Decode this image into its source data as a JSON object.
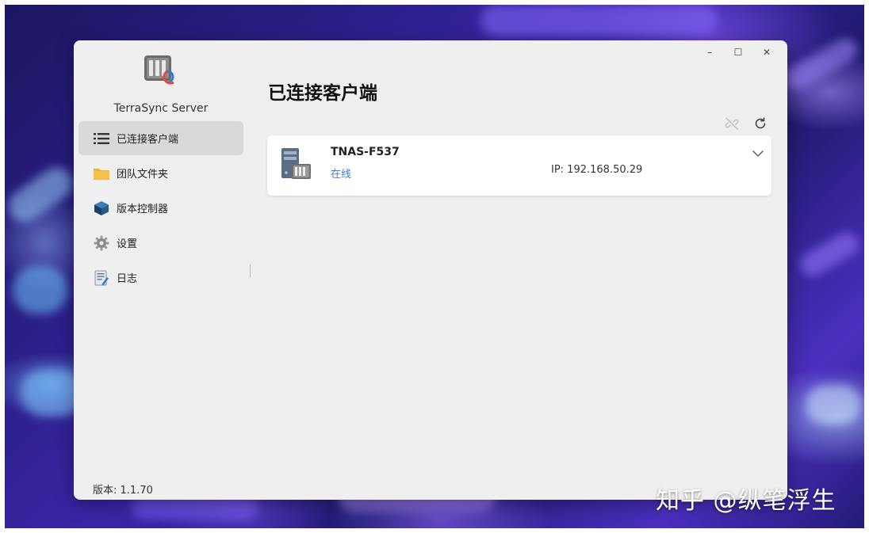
{
  "app": {
    "name": "TerraSync Server",
    "version_label": "版本: 1.1.70"
  },
  "window_controls": {
    "minimize": "–",
    "maximize": "☐",
    "close": "✕"
  },
  "sidebar": {
    "items": [
      {
        "label": "已连接客户端",
        "icon": "list-icon",
        "active": true
      },
      {
        "label": "团队文件夹",
        "icon": "folder-icon",
        "active": false
      },
      {
        "label": "版本控制器",
        "icon": "cube-icon",
        "active": false
      },
      {
        "label": "设置",
        "icon": "gear-icon",
        "active": false
      },
      {
        "label": "日志",
        "icon": "log-icon",
        "active": false
      }
    ]
  },
  "main": {
    "title": "已连接客户端",
    "toolbar": {
      "unlink_icon": "unlink-icon",
      "refresh_icon": "refresh-icon"
    },
    "clients": [
      {
        "name": "TNAS-F537",
        "status": "在线",
        "ip": "IP: 192.168.50.29",
        "icon": "nas-server-icon"
      }
    ]
  },
  "colors": {
    "accent_blue": "#3f7fd0",
    "active_nav": "#d9d9d9",
    "window_bg": "#efefef",
    "logo_red": "#e8453c",
    "logo_blue": "#2d7fd3",
    "folder_yellow": "#f7c04a"
  },
  "watermark": "知乎 @纵笔浮生"
}
